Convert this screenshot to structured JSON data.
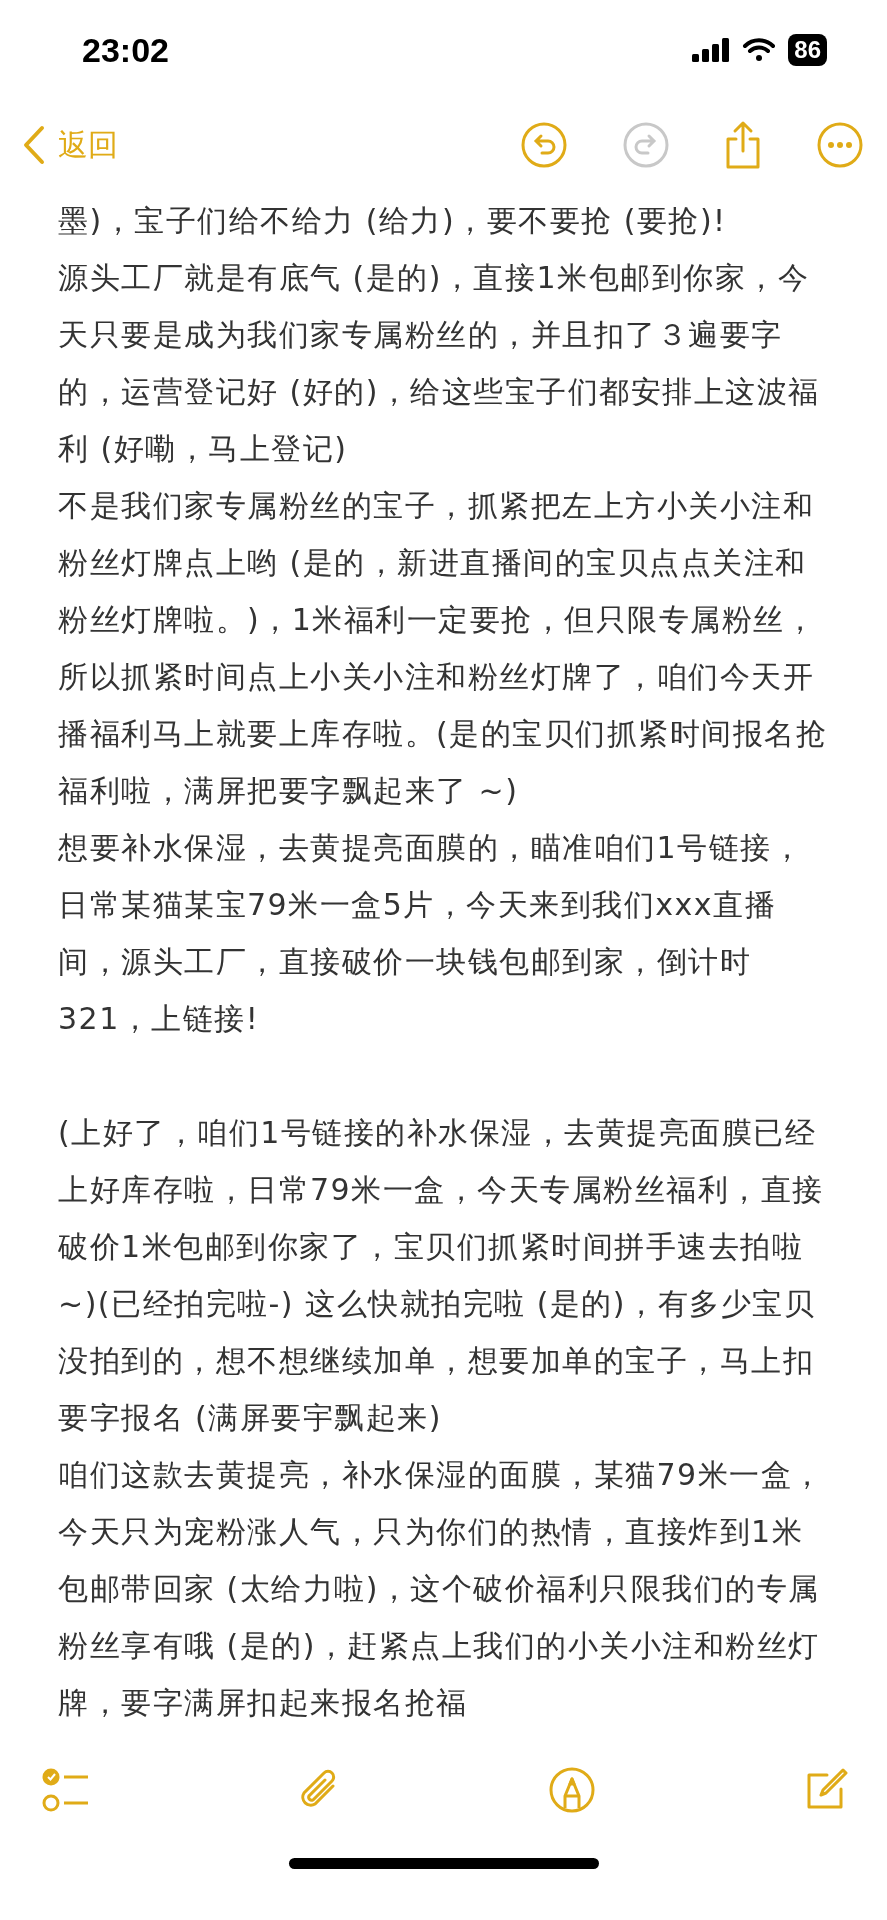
{
  "status_bar": {
    "time": "23:02",
    "battery": "86"
  },
  "nav": {
    "back_label": "返回",
    "actions": [
      {
        "kind": "undo",
        "disabled": false
      },
      {
        "kind": "redo",
        "disabled": true
      },
      {
        "kind": "share",
        "disabled": false
      },
      {
        "kind": "more",
        "disabled": false
      }
    ]
  },
  "note": {
    "sections": [
      {
        "paragraphs": [
          "墨)，宝子们给不给力 (给力)，要不要抢 (要抢)!",
          "源头工厂就是有底气 (是的)，直接1米包邮到你家，今天只要是成为我们家专属粉丝的，并且扣了３遍要字的，运营登记好 (好的)，给这些宝子们都安排上这波福利 (好嘞，马上登记)",
          "不是我们家专属粉丝的宝子，抓紧把左上方小关小注和粉丝灯牌点上哟 (是的，新进直播间的宝贝点点关注和粉丝灯牌啦。)，1米福利一定要抢，但只限专属粉丝，所以抓紧时间点上小关小注和粉丝灯牌了，咱们今天开播福利马上就要上库存啦。(是的宝贝们抓紧时间报名抢福利啦，满屏把要字飘起来了 ~)",
          "想要补水保湿，去黄提亮面膜的，瞄准咱们1号链接，日常某猫某宝79米一盒5片，今天来到我们xxx直播间，源头工厂，直接破价一块钱包邮到家，倒计时321，上链接!"
        ]
      },
      {
        "paragraphs": [
          "(上好了，咱们1号链接的补水保湿，去黄提亮面膜已经上好库存啦，日常79米一盒，今天专属粉丝福利，直接破价1米包邮到你家了，宝贝们抓紧时间拼手速去拍啦 ~)(已经拍完啦-) 这么快就拍完啦 (是的)，有多少宝贝没拍到的，想不想继续加单，想要加单的宝子，马上扣要字报名 (满屏要宇飘起来)",
          "咱们这款去黄提亮，补水保湿的面膜，某猫79米一盒，今天只为宠粉涨人气，只为你们的热情，直接炸到1米包邮带回家 (太给力啦)，这个破价福利只限我们的专属粉丝享有哦 (是的)，赶紧点上我们的小关小注和粉丝灯牌，要字满屏扣起来报名抢福"
        ]
      }
    ]
  },
  "toolbar": [
    {
      "kind": "checklist"
    },
    {
      "kind": "attachment"
    },
    {
      "kind": "markup"
    },
    {
      "kind": "compose"
    }
  ]
}
